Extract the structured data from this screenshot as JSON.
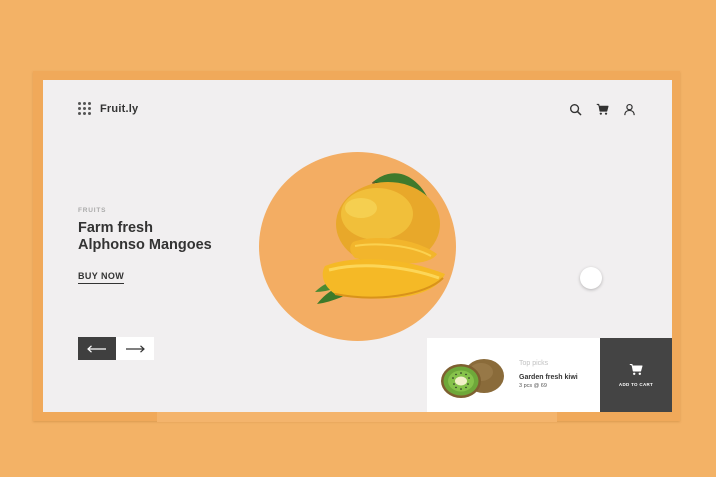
{
  "header": {
    "brand": "Fruit.ly",
    "icons": [
      "menu-grid-icon",
      "search-icon",
      "cart-icon",
      "user-icon"
    ]
  },
  "hero": {
    "eyebrow": "FRUITS",
    "title_line1": "Farm fresh",
    "title_line2": "Alphonso Mangoes",
    "cta": "BUY NOW"
  },
  "carousel": {
    "prev_icon": "arrow-left-icon",
    "next_icon": "arrow-right-icon"
  },
  "top_picks": {
    "label": "Top picks",
    "product_name": "Garden fresh kiwi",
    "product_meta": "3 pcs @ 69",
    "add_to_cart": "ADD TO CART"
  },
  "colors": {
    "background": "#f3b266",
    "card": "#f1eff0",
    "accent_circle": "#f3ad63",
    "dark": "#3f3f3f"
  }
}
